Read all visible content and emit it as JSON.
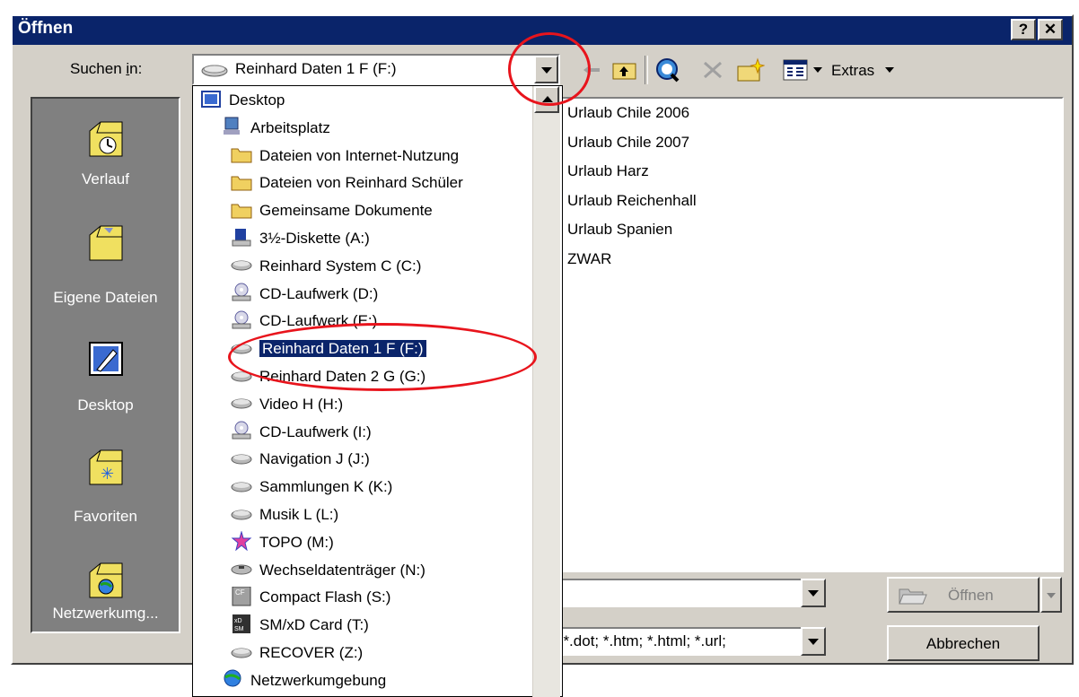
{
  "window": {
    "title": "Öffnen",
    "help_button": "?",
    "close_button": "✕"
  },
  "lookin": {
    "label": "Suchen in:",
    "value": "Reinhard Daten 1 F (F:)"
  },
  "toolbar": {
    "extras_label": "Extras"
  },
  "sidebar": {
    "items": [
      {
        "label": "Verlauf",
        "icon": "history-folder-icon"
      },
      {
        "label": "Eigene Dateien",
        "icon": "my-documents-folder-icon"
      },
      {
        "label": "Desktop",
        "icon": "desktop-icon"
      },
      {
        "label": "Favoriten",
        "icon": "favorites-folder-icon"
      },
      {
        "label": "Netzwerkumg...",
        "icon": "network-folder-icon"
      }
    ]
  },
  "dropdown": {
    "items": [
      {
        "label": "Desktop",
        "icon": "desktop-icon",
        "level": 0
      },
      {
        "label": "Arbeitsplatz",
        "icon": "computer-icon",
        "level": 1
      },
      {
        "label": "Dateien von Internet-Nutzung",
        "icon": "folder-icon",
        "level": 2
      },
      {
        "label": "Dateien von Reinhard Schüler",
        "icon": "folder-icon",
        "level": 2
      },
      {
        "label": "Gemeinsame Dokumente",
        "icon": "folder-icon",
        "level": 2
      },
      {
        "label": "3½-Diskette (A:)",
        "icon": "floppy-drive-icon",
        "level": 2
      },
      {
        "label": "Reinhard System C (C:)",
        "icon": "hard-drive-icon",
        "level": 2
      },
      {
        "label": "CD-Laufwerk (D:)",
        "icon": "cd-drive-icon",
        "level": 2
      },
      {
        "label": "CD-Laufwerk (E:)",
        "icon": "cd-drive-icon",
        "level": 2
      },
      {
        "label": "Reinhard Daten 1 F (F:)",
        "icon": "hard-drive-icon",
        "level": 2,
        "selected": true
      },
      {
        "label": "Reinhard Daten 2 G (G:)",
        "icon": "hard-drive-icon",
        "level": 2
      },
      {
        "label": "Video H (H:)",
        "icon": "hard-drive-icon",
        "level": 2
      },
      {
        "label": "CD-Laufwerk (I:)",
        "icon": "cd-drive-icon",
        "level": 2
      },
      {
        "label": "Navigation J (J:)",
        "icon": "hard-drive-icon",
        "level": 2
      },
      {
        "label": "Sammlungen  K (K:)",
        "icon": "hard-drive-icon",
        "level": 2
      },
      {
        "label": "Musik L (L:)",
        "icon": "hard-drive-icon",
        "level": 2
      },
      {
        "label": "TOPO (M:)",
        "icon": "topo-drive-icon",
        "level": 2
      },
      {
        "label": "Wechseldatenträger (N:)",
        "icon": "removable-drive-icon",
        "level": 2
      },
      {
        "label": "Compact Flash (S:)",
        "icon": "compact-flash-icon",
        "level": 2
      },
      {
        "label": "SM/xD Card (T:)",
        "icon": "smxd-card-icon",
        "level": 2
      },
      {
        "label": "RECOVER (Z:)",
        "icon": "hard-drive-icon",
        "level": 2
      },
      {
        "label": "Netzwerkumgebung",
        "icon": "network-icon",
        "level": 1
      }
    ]
  },
  "files": [
    "Urlaub Chile 2006",
    "Urlaub Chile 2007",
    "Urlaub Harz",
    "Urlaub Reichenhall",
    "Urlaub Spanien",
    "ZWAR"
  ],
  "filename": {
    "value": ""
  },
  "filetype": {
    "value": "; *.dot; *.htm; *.html; *.url;"
  },
  "buttons": {
    "open": "Öffnen",
    "cancel": "Abbrechen"
  },
  "colors": {
    "titlebar": "#0a246a",
    "dialog": "#d4d0c8",
    "sidebar": "#808080",
    "selection": "#0a246a",
    "annotation": "#e8141c"
  }
}
